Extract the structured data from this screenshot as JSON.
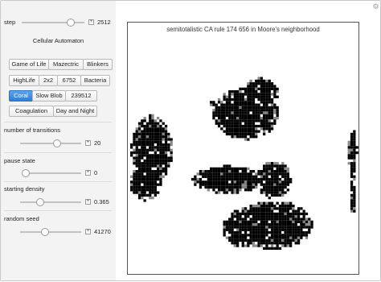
{
  "controls": {
    "step": {
      "label": "step",
      "value": "2512",
      "fraction": 0.78
    },
    "rule_title": "Cellular Automaton",
    "button_rows": [
      [
        "Game of Life",
        "Mazectric",
        "Blinkers"
      ],
      [
        "HighLife",
        "2x2",
        "6752",
        "Bacteria"
      ],
      [
        "Coral",
        "Slow Blob",
        "239512"
      ],
      [
        "Coagulation",
        "Day and Night"
      ]
    ],
    "selected_button": "Coral",
    "transitions": {
      "label": "number of transitions",
      "value": "20",
      "fraction": 0.6
    },
    "pause": {
      "label": "pause state",
      "value": "0",
      "fraction": 0.0
    },
    "density": {
      "label": "starting density",
      "value": "0.365",
      "fraction": 0.33
    },
    "seed": {
      "label": "random seed",
      "value": "41270",
      "fraction": 0.41
    }
  },
  "plot": {
    "title": "semitotalistic CA rule 174 656 in Moore's neighborhood"
  },
  "colors": {
    "selected": "#3a8be3",
    "cell": "#000000",
    "panel": "#f3f3f3"
  },
  "icons": {
    "settings": "gear-icon",
    "increment": "plus-icon"
  }
}
